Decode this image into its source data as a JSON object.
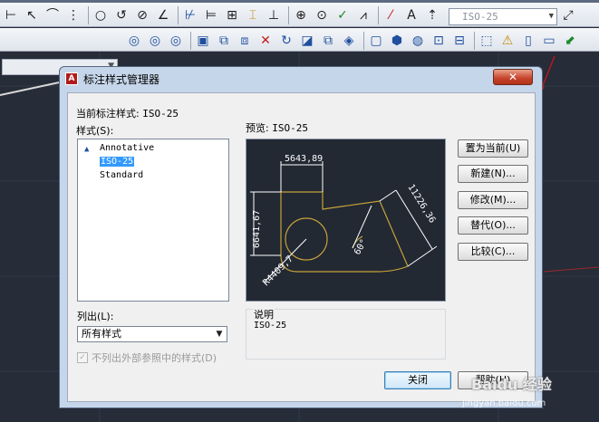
{
  "toolbar1": {
    "icons_a": [
      "linear-dim-icon",
      "aligned-dim-icon",
      "arc-length-icon",
      "ordinate-dim-icon"
    ],
    "icons_b": [
      "radius-dim-icon",
      "jogged-dim-icon",
      "diameter-dim-icon",
      "angular-dim-icon"
    ],
    "icons_c": [
      "quick-dim-icon",
      "baseline-dim-icon",
      "continue-dim-icon",
      "dim-space-icon",
      "dim-break-icon"
    ],
    "icons_d": [
      "tolerance-icon",
      "center-mark-icon",
      "inspect-icon",
      "jog-line-icon"
    ],
    "icons_e": [
      "dim-edit-icon",
      "dim-text-edit-icon",
      "dim-update-icon"
    ],
    "dimstyle_value": "ISO-25"
  },
  "toolbar2": {
    "icons": [
      "union-icon",
      "subtract-icon",
      "intersect-icon",
      "extrude-face-icon",
      "move-face-icon",
      "offset-face-icon",
      "delete-face-icon",
      "rotate-face-icon",
      "taper-face-icon",
      "copy-face-icon",
      "color-face-icon",
      "copy-edge-icon",
      "color-edge-icon",
      "imprint-icon",
      "clean-icon",
      "separate-icon",
      "shell-icon",
      "check-icon",
      "three-d-icon"
    ]
  },
  "dialog": {
    "title": "标注样式管理器",
    "app_icon_letter": "A",
    "close_glyph": "✕",
    "current_style_label": "当前标注样式:",
    "current_style_value": "ISO-25",
    "styles_label": "样式(S):",
    "styles": [
      "Annotative",
      "ISO-25",
      "Standard"
    ],
    "selected_style": "ISO-25",
    "preview_label": "预览:",
    "preview_value": "ISO-25",
    "list_label": "列出(L):",
    "list_value": "所有样式",
    "xref_checkbox_label": "不列出外部参照中的样式(D)",
    "xref_checked": true,
    "description_label": "说明",
    "description_value": "ISO-25",
    "buttons": {
      "set_current": "置为当前(U)",
      "new": "新建(N)...",
      "modify": "修改(M)...",
      "override": "替代(O)...",
      "compare": "比较(C)...",
      "close": "关闭",
      "help": "帮助(H)"
    },
    "preview_dims": {
      "top": "5643,89",
      "left": "6641,67",
      "aligned": "11226,36",
      "radius": "R4409,7",
      "angle": "60°"
    }
  },
  "watermark": {
    "line1": "Baidu 经验",
    "line2": "jingyan.baidu.com"
  }
}
